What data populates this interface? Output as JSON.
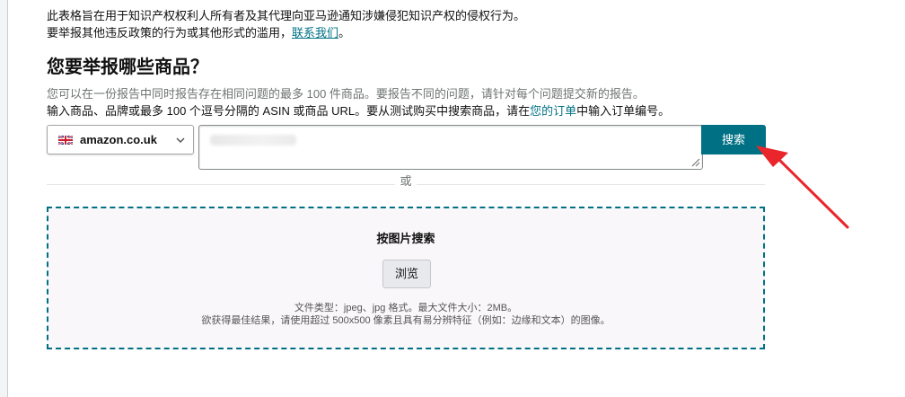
{
  "intro": {
    "line1": "此表格旨在用于知识产权权利人所有者及其代理向亚马逊通知涉嫌侵犯知识产权的侵权行为。",
    "line2_prefix": "要举报其他违反政策的行为或其他形式的滥用，",
    "contact_link": "联系我们",
    "line2_suffix": "。"
  },
  "heading": "您要举报哪些商品？",
  "hint_gray": "您可以在一份报告中同时报告存在相同问题的最多 100 件商品。要报告不同的问题，请针对每个问题提交新的报告。",
  "hint_dark": {
    "prefix": "输入商品、品牌或最多 100 个逗号分隔的 ASIN 或商品 URL。要从测试购买中搜索商品，请在",
    "orders_link": "您的订单",
    "suffix": "中输入订单编号。"
  },
  "marketplace": {
    "selected": "amazon.co.uk",
    "flag_icon": "uk-flag-icon"
  },
  "search": {
    "button_label": "搜索"
  },
  "or_label": "或",
  "image_search": {
    "title": "按图片搜索",
    "browse_label": "浏览",
    "note1": "文件类型：jpeg、jpg 格式。最大文件大小：2MB。",
    "note2": "欲获得最佳结果，请使用超过 500x500 像素且具有易分辨特征（例如：边缘和文本）的图像。"
  },
  "colors": {
    "accent": "#007185",
    "annotation_arrow": "#e8262b"
  }
}
